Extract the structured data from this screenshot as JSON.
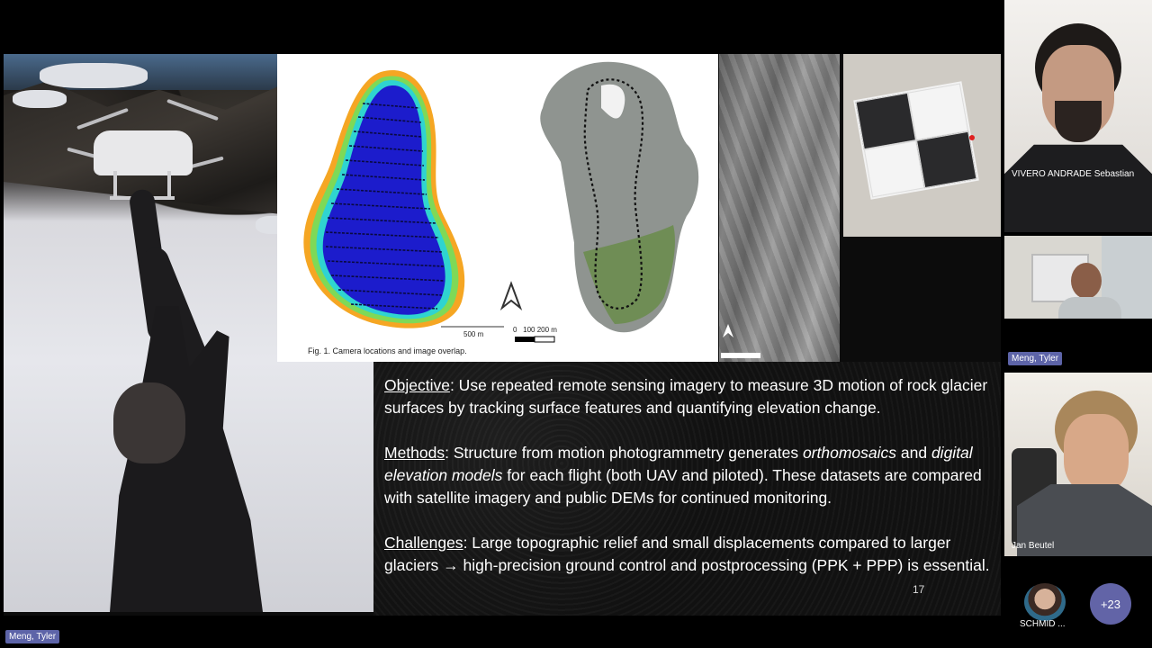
{
  "slide": {
    "figure_caption": "Fig. 1. Camera locations and image overlap.",
    "scale_500m": "500 m",
    "scale_ticks": "0   100 200 m",
    "paragraphs": [
      {
        "heading": "Objective",
        "text": ": Use repeated remote sensing imagery to measure 3D motion of rock glacier surfaces by tracking surface features and quantifying elevation change."
      },
      {
        "heading": "Methods",
        "text_1": ": Structure from motion photogrammetry generates ",
        "em_1": "orthomosaics",
        "text_2": " and ",
        "em_2": "digital elevation models",
        "text_3": " for each flight (both UAV and piloted). These datasets are compared with satellite imagery and public DEMs for continued monitoring."
      },
      {
        "heading": "Challenges",
        "text": ": Large topographic relief and small displacements compared to larger glaciers → high-precision ground control and postprocessing (PPK + PPP) is essential."
      }
    ],
    "page_number": "17"
  },
  "presenter_label": "Meng, Tyler",
  "participants": [
    {
      "name": "VIVERO ANDRADE Sebastian"
    },
    {
      "name": "Meng, Tyler"
    },
    {
      "name": "Jan Beutel"
    }
  ],
  "overflow": {
    "avatar_name": "SCHMID ...",
    "more_count": "+23"
  },
  "colors": {
    "badge": "#5d64a8",
    "more_button": "#6264a7"
  }
}
